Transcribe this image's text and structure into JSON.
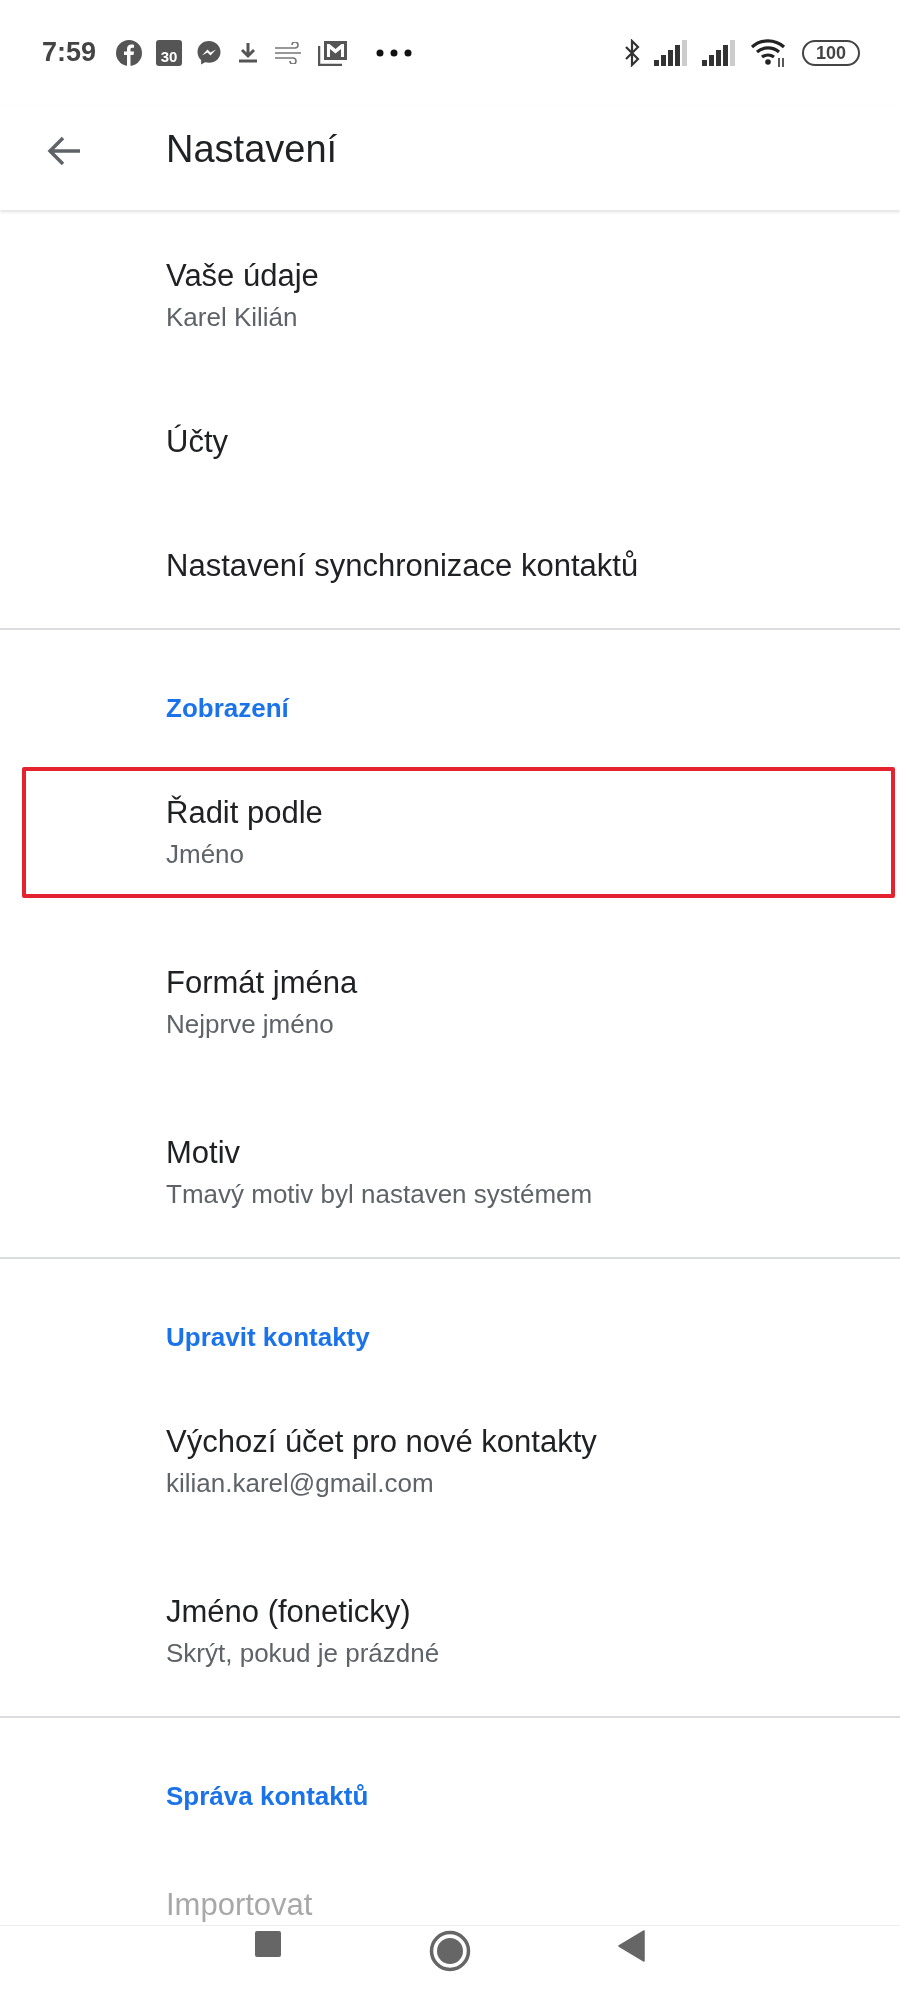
{
  "status_bar": {
    "time": "7:59",
    "calendar_day": "30",
    "battery": "100"
  },
  "app_bar": {
    "title": "Nastavení"
  },
  "sections": [
    {
      "items": [
        {
          "title": "Vaše údaje",
          "subtitle": "Karel Kilián",
          "highlighted": false
        },
        {
          "title": "Účty",
          "highlighted": false
        },
        {
          "title": "Nastavení synchronizace kontaktů",
          "highlighted": false
        }
      ]
    },
    {
      "header": "Zobrazení",
      "items": [
        {
          "title": "Řadit podle",
          "subtitle": "Jméno",
          "highlighted": true
        },
        {
          "title": "Formát jména",
          "subtitle": "Nejprve jméno",
          "highlighted": false
        },
        {
          "title": "Motiv",
          "subtitle": "Tmavý motiv byl nastaven systémem",
          "highlighted": false
        }
      ]
    },
    {
      "header": "Upravit kontakty",
      "items": [
        {
          "title": "Výchozí účet pro nové kontakty",
          "subtitle": "kilian.karel@gmail.com",
          "highlighted": false
        },
        {
          "title": "Jméno (foneticky)",
          "subtitle": "Skrýt, pokud je prázdné",
          "highlighted": false
        }
      ]
    },
    {
      "header": "Správa kontaktů",
      "items": [
        {
          "title": "Importovat",
          "highlighted": false
        }
      ]
    }
  ]
}
